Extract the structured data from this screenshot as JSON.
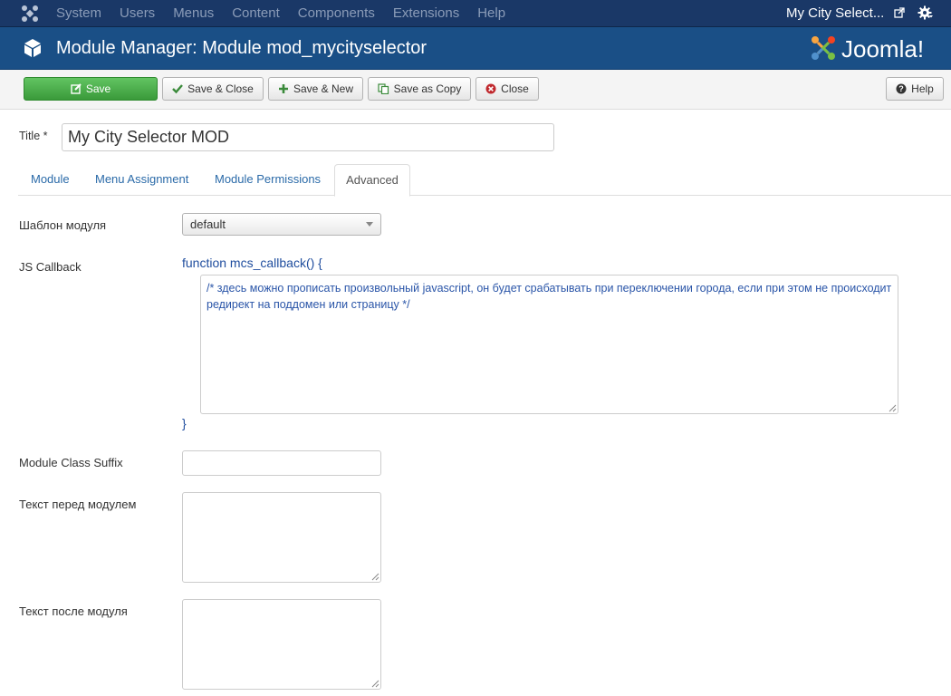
{
  "navbar": {
    "menu": [
      "System",
      "Users",
      "Menus",
      "Content",
      "Components",
      "Extensions",
      "Help"
    ],
    "site_link": "My City Select..."
  },
  "header": {
    "title": "Module Manager: Module mod_mycityselector",
    "brand": "Joomla!"
  },
  "toolbar": {
    "save": "Save",
    "save_close": "Save & Close",
    "save_new": "Save & New",
    "save_copy": "Save as Copy",
    "close": "Close",
    "help": "Help"
  },
  "form": {
    "title_label": "Title *",
    "title_value": "My City Selector MOD",
    "tabs": [
      "Module",
      "Menu Assignment",
      "Module Permissions",
      "Advanced"
    ],
    "active_tab": "Advanced",
    "template_label": "Шаблон модуля",
    "template_value": "default",
    "js_callback_label": "JS Callback",
    "js_open": "function mcs_callback() {",
    "js_body": "/* здесь можно прописать произвольный javascript, он будет срабатывать при переключении города, если при этом не происходит редирект на поддомен или страницу */",
    "js_close": "}",
    "suffix_label": "Module Class Suffix",
    "suffix_value": "",
    "before_label": "Текст перед модулем",
    "before_value": "",
    "after_label": "Текст после модуля",
    "after_value": ""
  },
  "colors": {
    "navbar": "#1a3867",
    "header": "#1a4f86",
    "save_button": "#46a546",
    "link": "#2a6aa8"
  }
}
